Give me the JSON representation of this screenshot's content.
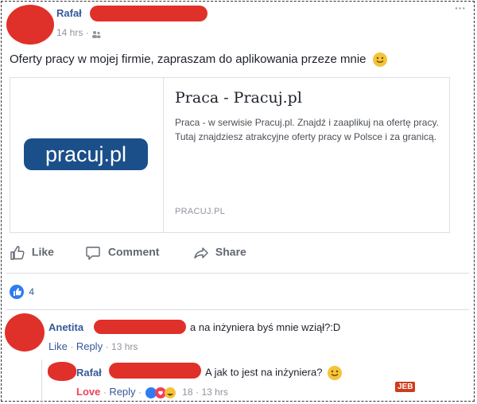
{
  "post": {
    "author": "Rafał",
    "time": "14 hrs",
    "audience_icon": "friends-icon",
    "text": "Oferty pracy w mojej firmie, zapraszam do aplikowania przeze mnie",
    "menu": "···",
    "card": {
      "logo_text": "pracuj.pl",
      "title": "Praca - Pracuj.pl",
      "description": "Praca - w serwisie Pracuj.pl. Znajdź i zaaplikuj na ofertę pracy. Tutaj znajdziesz atrakcyjne oferty pracy w Polsce i za granicą.",
      "domain": "PRACUJ.PL"
    },
    "actions": {
      "like": "Like",
      "comment": "Comment",
      "share": "Share"
    },
    "reaction_count": "4"
  },
  "comments": [
    {
      "author": "Anetita",
      "text": "a na inżyniera byś mnie wziął?:D",
      "like": "Like",
      "reply": "Reply",
      "time": "13 hrs"
    }
  ],
  "reply": {
    "author": "Rafał",
    "text": "A jak to jest na inżyniera?",
    "love": "Love",
    "reply": "Reply",
    "reaction_count": "18",
    "time": "13 hrs"
  },
  "watermark": "JEB"
}
